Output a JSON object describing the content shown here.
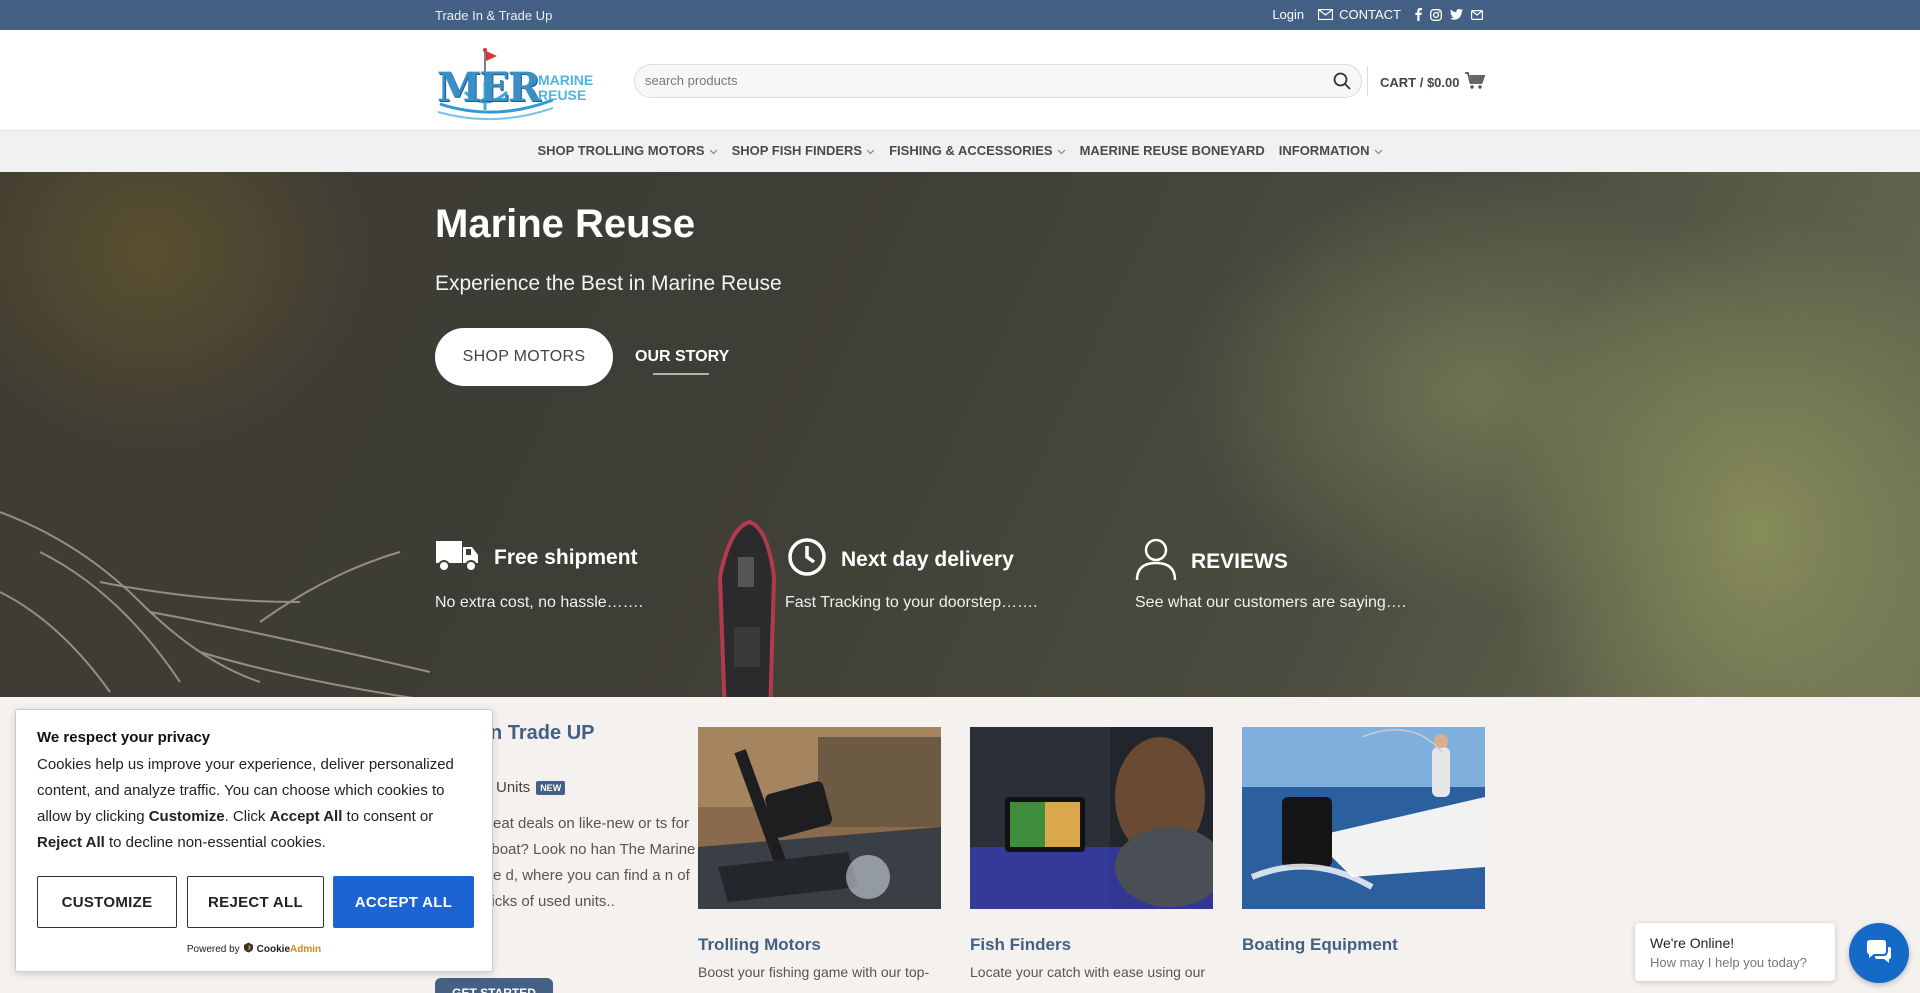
{
  "topbar": {
    "tagline": "Trade In & Trade Up",
    "login": "Login",
    "contact": "CONTACT"
  },
  "header": {
    "logo_text_1": "MARINE",
    "logo_text_2": "REUSE",
    "logo_letters": "MER",
    "search_placeholder": "search products",
    "cart_label": "CART / $0.00"
  },
  "nav": {
    "items": [
      {
        "label": "SHOP TROLLING MOTORS"
      },
      {
        "label": "SHOP FISH FINDERS"
      },
      {
        "label": "FISHING & ACCESSORIES"
      },
      {
        "label": "MAERINE REUSE BONEYARD"
      },
      {
        "label": "INFORMATION"
      }
    ]
  },
  "hero": {
    "title": "Marine Reuse",
    "subtitle": "Experience the Best in Marine Reuse",
    "btn_shop": "SHOP MOTORS",
    "btn_story": "OUR STORY",
    "features": [
      {
        "title": "Free shipment",
        "desc": "No extra cost, no hassle……."
      },
      {
        "title": "Next day delivery",
        "desc": "Fast Tracking to your doorstep……."
      },
      {
        "title": "REVIEWS",
        "desc": "See what our customers are saying…."
      }
    ]
  },
  "intro": {
    "title": "n Trade UP",
    "sub": "Units",
    "badge": "NEW",
    "text": "for great deals on like-new or ts for your boat? Look no han The Marine Reuse d, where you can find a n of top picks of used units..",
    "button": "GET STARTED"
  },
  "cards": [
    {
      "title": "Trolling Motors",
      "desc": "Boost your fishing game with our top-"
    },
    {
      "title": "Fish Finders",
      "desc": "Locate your catch with ease using our"
    },
    {
      "title": "Boating Equipment",
      "desc": ""
    }
  ],
  "cookie": {
    "title": "We respect your privacy",
    "text_1": "Cookies help us improve your experience, deliver personalized content, and analyze traffic. You can choose which cookies to allow by clicking ",
    "bold_customize": "Customize",
    "text_2": ". Click ",
    "bold_accept": "Accept All",
    "text_3": " to consent or ",
    "bold_reject": "Reject All",
    "text_4": " to decline non-essential cookies.",
    "btn_customize": "CUSTOMIZE",
    "btn_reject": "REJECT ALL",
    "btn_accept": "ACCEPT ALL",
    "powered_by": "Powered by",
    "brand_1": "Cookie",
    "brand_2": "Admin"
  },
  "chat": {
    "line1": "We're Online!",
    "line2": "How may I help you today?"
  },
  "colors": {
    "topbar": "#446084",
    "accent": "#446084",
    "accept_button": "#1c63d3",
    "chat_button": "#1569c7"
  }
}
